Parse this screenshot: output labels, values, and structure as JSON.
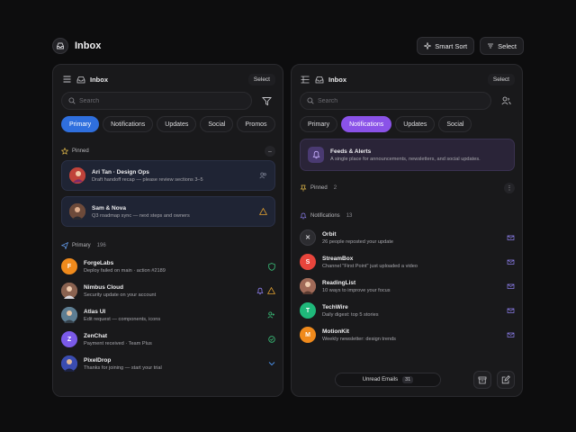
{
  "app": {
    "title": "Inbox",
    "actions": [
      {
        "label": "Smart Sort",
        "icon": "sparkle-icon"
      },
      {
        "label": "Select",
        "icon": "sort-icon"
      }
    ]
  },
  "left_panel": {
    "title": "Inbox",
    "select_label": "Select",
    "search_placeholder": "Search",
    "tabs": [
      "Primary",
      "Notifications",
      "Updates",
      "Social",
      "Promos"
    ],
    "active_tab": "Primary",
    "pinned": {
      "label": "Pinned",
      "items": [
        {
          "name": "Ari Tan · Design Ops",
          "snippet": "Draft handoff recap — please review sections 3–5"
        },
        {
          "name": "Sam & Nova",
          "snippet": "Q3 roadmap sync — next steps and owners"
        }
      ]
    },
    "primary": {
      "label": "Primary",
      "count": "196",
      "items": [
        {
          "initial": "F",
          "name": "ForgeLabs",
          "snippet": "Deploy failed on main · action #2189",
          "avatar_color": "#f08a1c"
        },
        {
          "initial": "",
          "name": "Nimbus Cloud",
          "snippet": "Security update on your account",
          "avatar_color": "#a07560"
        },
        {
          "initial": "",
          "name": "Atlas UI",
          "snippet": "Edit request — components, icons",
          "avatar_color": "#6a8fa8"
        },
        {
          "initial": "Z",
          "name": "ZenChat",
          "snippet": "Payment received · Team Plus",
          "avatar_color": "#7a5ae8"
        },
        {
          "initial": "",
          "name": "PixelDrop",
          "snippet": "Thanks for joining — start your trial",
          "avatar_color": "#4a5ac8"
        }
      ]
    }
  },
  "right_panel": {
    "title": "Inbox",
    "select_label": "Select",
    "search_placeholder": "Search",
    "tabs": [
      "Primary",
      "Notifications",
      "Updates",
      "Social"
    ],
    "active_tab": "Notifications",
    "banner": {
      "title": "Feeds & Alerts",
      "text": "A single place for announcements, newsletters, and social updates."
    },
    "pinned": {
      "label": "Pinned",
      "count": "2"
    },
    "notifications": {
      "label": "Notifications",
      "count": "13",
      "items": [
        {
          "initial": "✕",
          "name": "Orbit",
          "snippet": "26 people reposted your update",
          "avatar_color": "#2c2c30"
        },
        {
          "initial": "S",
          "name": "StreamBox",
          "snippet": "Channel \"First Point\" just uploaded a video",
          "avatar_color": "#e8453c"
        },
        {
          "initial": "",
          "name": "ReadingList",
          "snippet": "10 ways to improve your focus",
          "avatar_color": "#b07a66"
        },
        {
          "initial": "T",
          "name": "TechWire",
          "snippet": "Daily digest: top 5 stories",
          "avatar_color": "#1fb87a"
        },
        {
          "initial": "M",
          "name": "MotionKit",
          "snippet": "Weekly newsletter: design trends",
          "avatar_color": "#f08a1c"
        }
      ]
    },
    "unread": {
      "label": "Unread Emails",
      "count": "31"
    }
  },
  "colors": {
    "primary_tab": "#2f6fde",
    "notifications_tab": "#8a52e8",
    "pinned_card": "#1f2434",
    "banner": "#2a2438"
  }
}
